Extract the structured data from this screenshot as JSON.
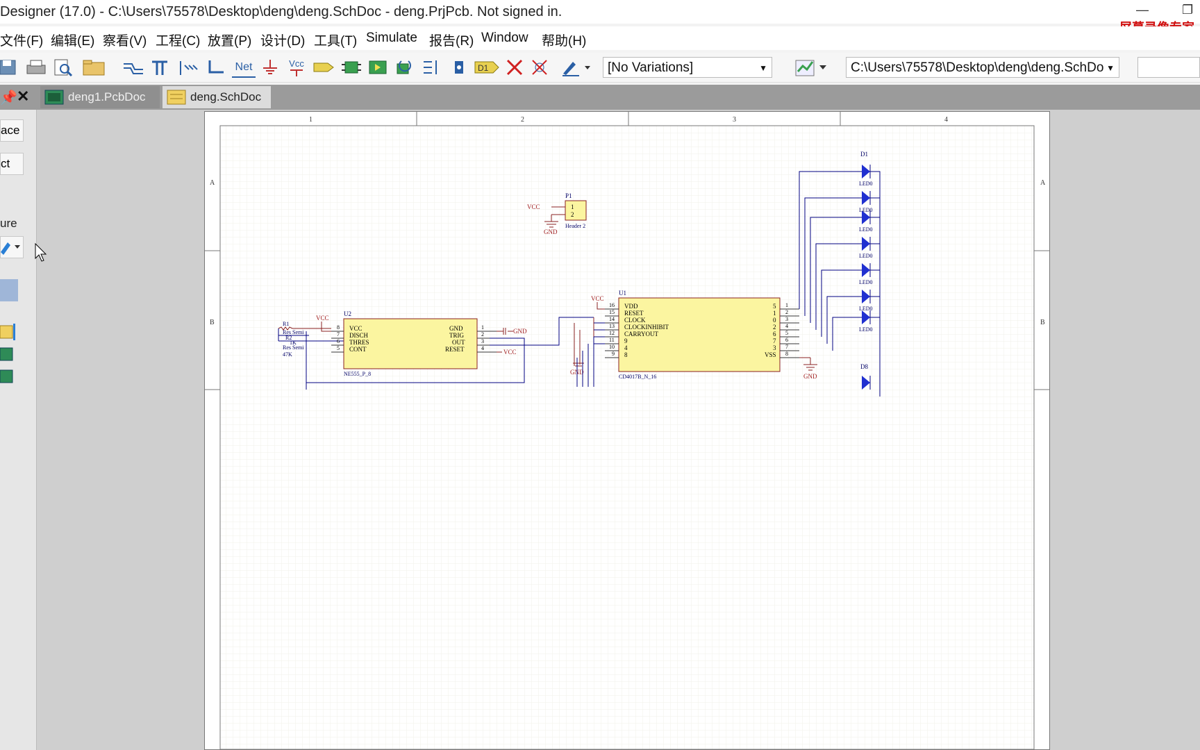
{
  "app": {
    "title": "Designer (17.0) - C:\\Users\\75578\\Desktop\\deng\\deng.SchDoc - deng.PrjPcb. Not signed in.",
    "watermark": "屏幕录像专家",
    "minimize": "—",
    "restore": "❐"
  },
  "menu": [
    "文件(F)",
    "编辑(E)",
    "察看(V)",
    "工程(C)",
    "放置(P)",
    "设计(D)",
    "工具(T)",
    "Simulate",
    "报告(R)",
    "Window",
    "帮助(H)"
  ],
  "toolbar": {
    "net_label": "Net",
    "vcc_label": "Vcc",
    "designator_label": "D1",
    "variations": "[No Variations]",
    "path": "C:\\Users\\75578\\Desktop\\deng\\deng.SchDo"
  },
  "tabs": [
    {
      "label": "deng1.PcbDoc *",
      "active": false
    },
    {
      "label": "deng.SchDoc",
      "active": true
    }
  ],
  "left_panel": {
    "btn1": "ace",
    "btn2": "ct",
    "label": "ure"
  },
  "schematic": {
    "columns": [
      "1",
      "2",
      "3",
      "4"
    ],
    "rows": [
      "A",
      "B"
    ],
    "p1": {
      "ref": "P1",
      "pins": [
        "1",
        "2"
      ],
      "name": "Header 2",
      "vcc": "VCC",
      "gnd": "GND"
    },
    "u2": {
      "ref": "U2",
      "name": "NE555_P_8",
      "left_pins": [
        "VCC",
        "DISCH",
        "THRES",
        "CONT"
      ],
      "left_nums": [
        "8",
        "7",
        "6",
        "5"
      ],
      "right_pins": [
        "GND",
        "TRIG",
        "OUT",
        "RESET"
      ],
      "right_nums": [
        "1",
        "2",
        "3",
        "4"
      ],
      "vcc": "VCC",
      "gnd": "GND",
      "vcc_reset": "VCC"
    },
    "r1": {
      "ref": "R1",
      "type1": "Res Semi",
      "ref2": "R2",
      "val1": "1K",
      "type2": "Res Semi",
      "val2": "47K"
    },
    "u1": {
      "ref": "U1",
      "name": "CD4017B_N_16",
      "left_pins": [
        "VDD",
        "RESET",
        "CLOCK",
        "CLOCKINHIBIT",
        "CARRYOUT",
        "9",
        "4",
        "8"
      ],
      "left_nums": [
        "16",
        "15",
        "14",
        "13",
        "12",
        "11",
        "10",
        "9"
      ],
      "right_pins": [
        "5",
        "1",
        "0",
        "2",
        "6",
        "7",
        "3",
        "VSS"
      ],
      "right_nums": [
        "1",
        "2",
        "3",
        "4",
        "5",
        "6",
        "7",
        "8"
      ],
      "vcc": "VCC",
      "gnd": "GND",
      "gnd2": "GND"
    },
    "leds": {
      "top": "D1",
      "label": "LED0",
      "bottom": "D8"
    }
  }
}
